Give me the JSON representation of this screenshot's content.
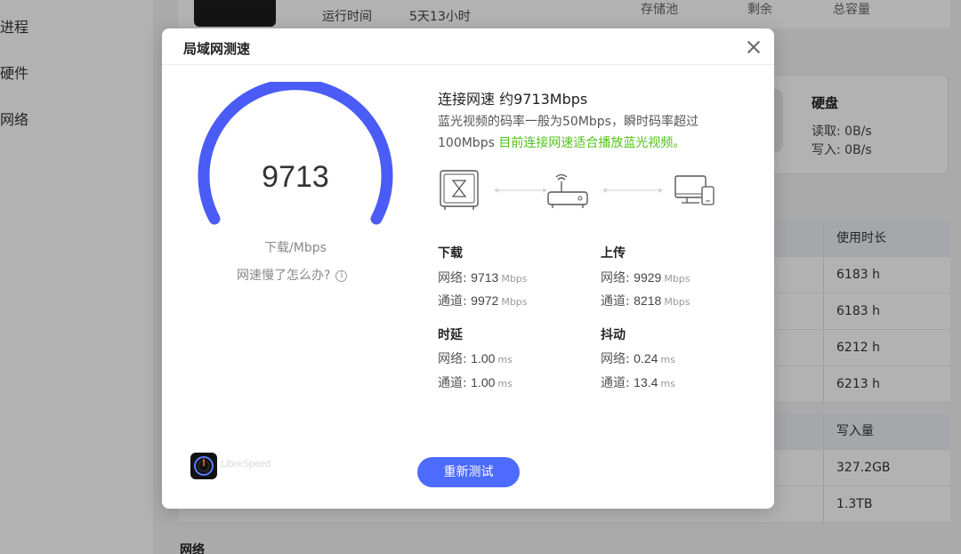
{
  "background": {
    "sidebar": [
      "进程",
      "硬件",
      "网络"
    ],
    "device_info": {
      "uptime_label": "运行时间",
      "uptime_value": "5天13小时"
    },
    "storage_header": [
      "存储池",
      "剩余",
      "总容量"
    ],
    "disk": {
      "title": "硬盘",
      "read": "读取: 0B/s",
      "write": "写入: 0B/s"
    },
    "table1": {
      "header": "使用时长",
      "rows": [
        "6183 h",
        "6183 h",
        "6212 h",
        "6213 h"
      ]
    },
    "table2": {
      "header": "写入量",
      "rows": [
        "327.2GB",
        "1.3TB"
      ]
    },
    "bottom_section": "网络"
  },
  "modal": {
    "title": "局域网测速",
    "gauge": {
      "value": "9713",
      "unit": "下载/Mbps",
      "fill_fraction": 1.0,
      "color": "#4a5cf5"
    },
    "help_text": "网速慢了怎么办?",
    "info_icon": "i",
    "connection_title": "连接网速 约9713Mbps",
    "description_line1": "蓝光视频的码率一般为50Mbps，瞬时码率超过",
    "description_line2_prefix": "100Mbps ",
    "description_line2_highlight": "目前连接网速适合播放蓝光视频。",
    "topology_icons": [
      "nas-device-icon",
      "router-icon",
      "computer-phone-icon"
    ],
    "download": {
      "title": "下载",
      "network_label": "网络: ",
      "network_value": "9713",
      "network_unit": "Mbps",
      "channel_label": "通道: ",
      "channel_value": "9972",
      "channel_unit": "Mbps"
    },
    "upload": {
      "title": "上传",
      "network_label": "网络: ",
      "network_value": "9929",
      "network_unit": "Mbps",
      "channel_label": "通道: ",
      "channel_value": "8218",
      "channel_unit": "Mbps"
    },
    "latency": {
      "title": "时延",
      "network_label": "网络: ",
      "network_value": "1.00",
      "network_unit": "ms",
      "channel_label": "通道: ",
      "channel_value": "1.00",
      "channel_unit": "ms"
    },
    "jitter": {
      "title": "抖动",
      "network_label": "网络: ",
      "network_value": "0.24",
      "network_unit": "ms",
      "channel_label": "通道: ",
      "channel_value": "13.4",
      "channel_unit": "ms"
    },
    "librespeed_label": "LibreSpeed",
    "retest_label": "重新测试"
  },
  "colors": {
    "accent": "#4d6bfe",
    "highlight_green": "#52c41a"
  }
}
